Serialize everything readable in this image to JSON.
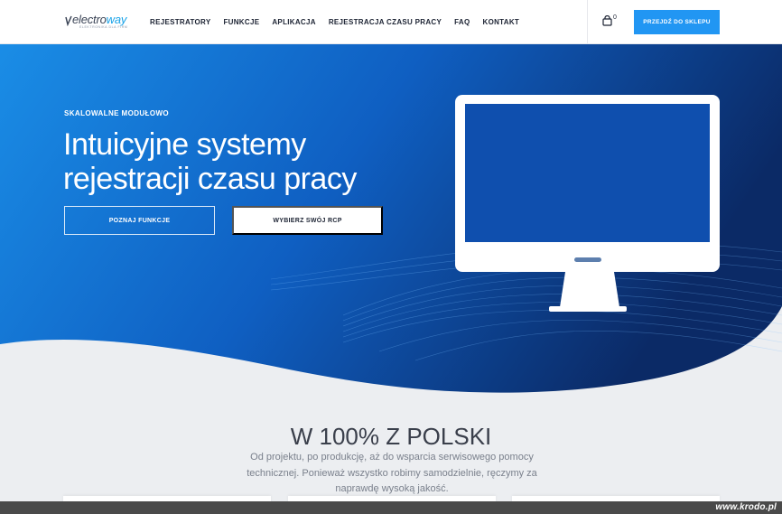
{
  "header": {
    "logo_text_main": "electro",
    "logo_text_accent": "way",
    "logo_subtitle": "ELEKTRONIKA DLA FIRM",
    "nav": [
      "REJESTRATORY",
      "FUNKCJE",
      "APLIKACJA",
      "REJESTRACJA CZASU PRACY",
      "FAQ",
      "KONTAKT"
    ],
    "cart_count": "0",
    "shop_button": "PRZEJDŹ DO SKLEPU"
  },
  "hero": {
    "kicker": "SKALOWALNE MODUŁOWO",
    "title_line1": "Intuicyjne systemy",
    "title_line2": "rejestracji czasu pracy",
    "btn_features": "POZNAJ FUNKCJE",
    "btn_choose": "WYBIERZ SWÓJ RCP"
  },
  "section": {
    "title": "W 100% Z POLSKI",
    "text": "Od projektu, po produkcję, aż do wsparcia serwisowego pomocy technicznej. Ponieważ wszystko robimy samodzielnie, ręczymy za naprawdę wysoką jakość."
  },
  "watermark": "www.krodo.pl",
  "colors": {
    "accent": "#2196f3",
    "hero_start": "#1a8de6",
    "hero_end": "#0b2a66",
    "logo_accent": "#1aa3e8"
  }
}
